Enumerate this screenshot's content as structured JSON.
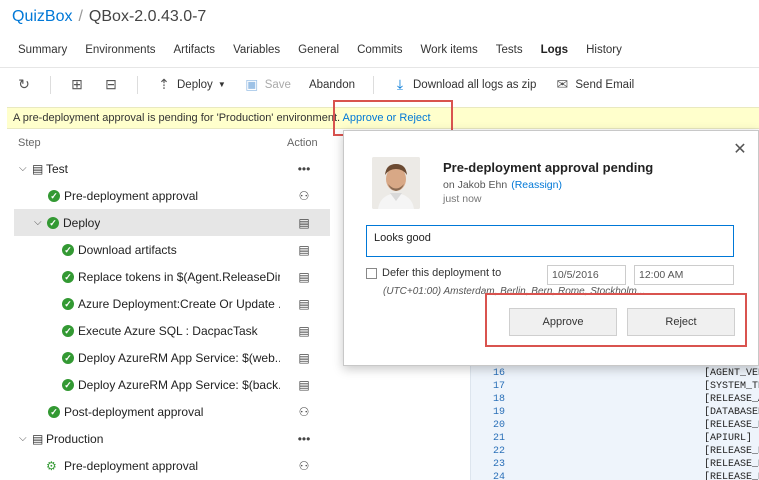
{
  "breadcrumb": {
    "project": "QuizBox",
    "separator": "/",
    "release": "QBox-2.0.43.0-7"
  },
  "tabs": [
    "Summary",
    "Environments",
    "Artifacts",
    "Variables",
    "General",
    "Commits",
    "Work items",
    "Tests",
    "Logs",
    "History"
  ],
  "active_tab": "Logs",
  "toolbar": {
    "deploy_label": "Deploy",
    "save_label": "Save",
    "abandon_label": "Abandon",
    "download_label": "Download all logs as zip",
    "email_label": "Send Email"
  },
  "banner": {
    "text": "A pre-deployment approval is pending for 'Production' environment.",
    "link": "Approve or Reject"
  },
  "columns": {
    "step": "Step",
    "action": "Action"
  },
  "tree": [
    {
      "label": "Test",
      "kind": "env",
      "action": "more"
    },
    {
      "label": "Pre-deployment approval",
      "kind": "step",
      "action": "person"
    },
    {
      "label": "Deploy",
      "kind": "phase",
      "action": "log",
      "selected": true
    },
    {
      "label": "Download artifacts",
      "kind": "task",
      "action": "log"
    },
    {
      "label": "Replace tokens in $(Agent.ReleaseDir...",
      "kind": "task",
      "action": "log"
    },
    {
      "label": "Azure Deployment:Create Or Update ...",
      "kind": "task",
      "action": "log"
    },
    {
      "label": "Execute Azure SQL : DacpacTask",
      "kind": "task",
      "action": "log"
    },
    {
      "label": "Deploy AzureRM App Service: $(web...",
      "kind": "task",
      "action": "log"
    },
    {
      "label": "Deploy AzureRM App Service: $(back...",
      "kind": "task",
      "action": "log"
    },
    {
      "label": "Post-deployment approval",
      "kind": "step",
      "action": "person"
    },
    {
      "label": "Production",
      "kind": "env",
      "action": "more"
    },
    {
      "label": "Pre-deployment approval",
      "kind": "pending",
      "action": "person-pending"
    }
  ],
  "log": {
    "line_numbers": [
      "16",
      "17",
      "18",
      "19",
      "20",
      "21",
      "22",
      "23",
      "24"
    ],
    "lines": [
      "[AGENT_VER",
      "[SYSTEM_TE",
      "[RELEASE_A",
      "[DATABASEN",
      "[RELEASE_E",
      "[APIURL] -",
      "[RELEASE_E",
      "[RELEASE_R",
      "[RELEASE_E"
    ]
  },
  "approval": {
    "title": "Pre-deployment approval pending",
    "on_prefix": "on Jakob Ehn",
    "reassign": "(Reassign)",
    "time": "just now",
    "comment": "Looks good",
    "defer_label": "Defer this deployment to",
    "date_value": "10/5/2016",
    "time_value": "12:00 AM",
    "timezone": "(UTC+01:00) Amsterdam, Berlin, Bern, Rome, Stockholm...",
    "approve_label": "Approve",
    "reject_label": "Reject"
  },
  "colors": {
    "accent": "#0078d7",
    "success": "#339933",
    "highlight": "#d9534f",
    "banner": "#ffffcc"
  }
}
